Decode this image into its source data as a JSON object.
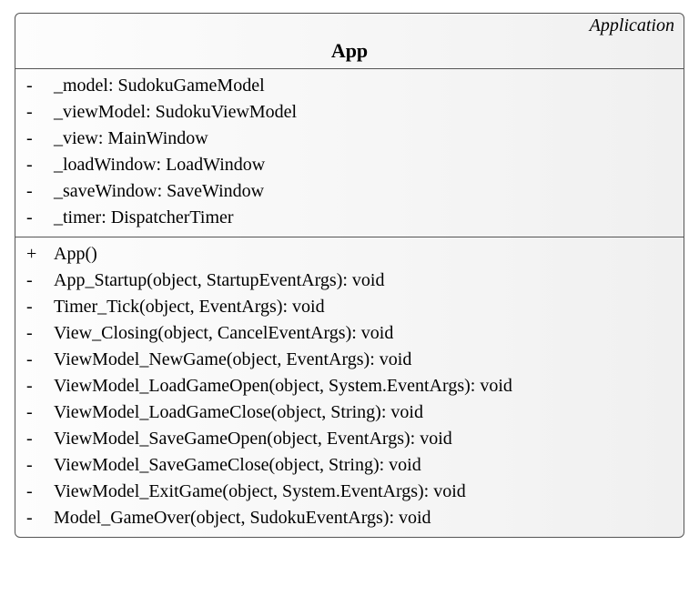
{
  "class": {
    "stereotype": "Application",
    "name": "App",
    "attributes": [
      {
        "vis": "-",
        "sig": "_model: SudokuGameModel"
      },
      {
        "vis": "-",
        "sig": "_viewModel: SudokuViewModel"
      },
      {
        "vis": "-",
        "sig": "_view: MainWindow"
      },
      {
        "vis": "-",
        "sig": "_loadWindow: LoadWindow"
      },
      {
        "vis": "-",
        "sig": "_saveWindow: SaveWindow"
      },
      {
        "vis": "-",
        "sig": "_timer: DispatcherTimer"
      }
    ],
    "operations": [
      {
        "vis": "+",
        "sig": "App()"
      },
      {
        "vis": "-",
        "sig": "App_Startup(object, StartupEventArgs): void"
      },
      {
        "vis": "-",
        "sig": "Timer_Tick(object, EventArgs): void"
      },
      {
        "vis": "-",
        "sig": "View_Closing(object, CancelEventArgs): void"
      },
      {
        "vis": "-",
        "sig": "ViewModel_NewGame(object, EventArgs): void"
      },
      {
        "vis": "-",
        "sig": "ViewModel_LoadGameOpen(object, System.EventArgs): void"
      },
      {
        "vis": "-",
        "sig": "ViewModel_LoadGameClose(object, String): void"
      },
      {
        "vis": "-",
        "sig": "ViewModel_SaveGameOpen(object, EventArgs): void"
      },
      {
        "vis": "-",
        "sig": "ViewModel_SaveGameClose(object, String): void"
      },
      {
        "vis": "-",
        "sig": "ViewModel_ExitGame(object, System.EventArgs): void"
      },
      {
        "vis": "-",
        "sig": "Model_GameOver(object, SudokuEventArgs): void"
      }
    ]
  }
}
